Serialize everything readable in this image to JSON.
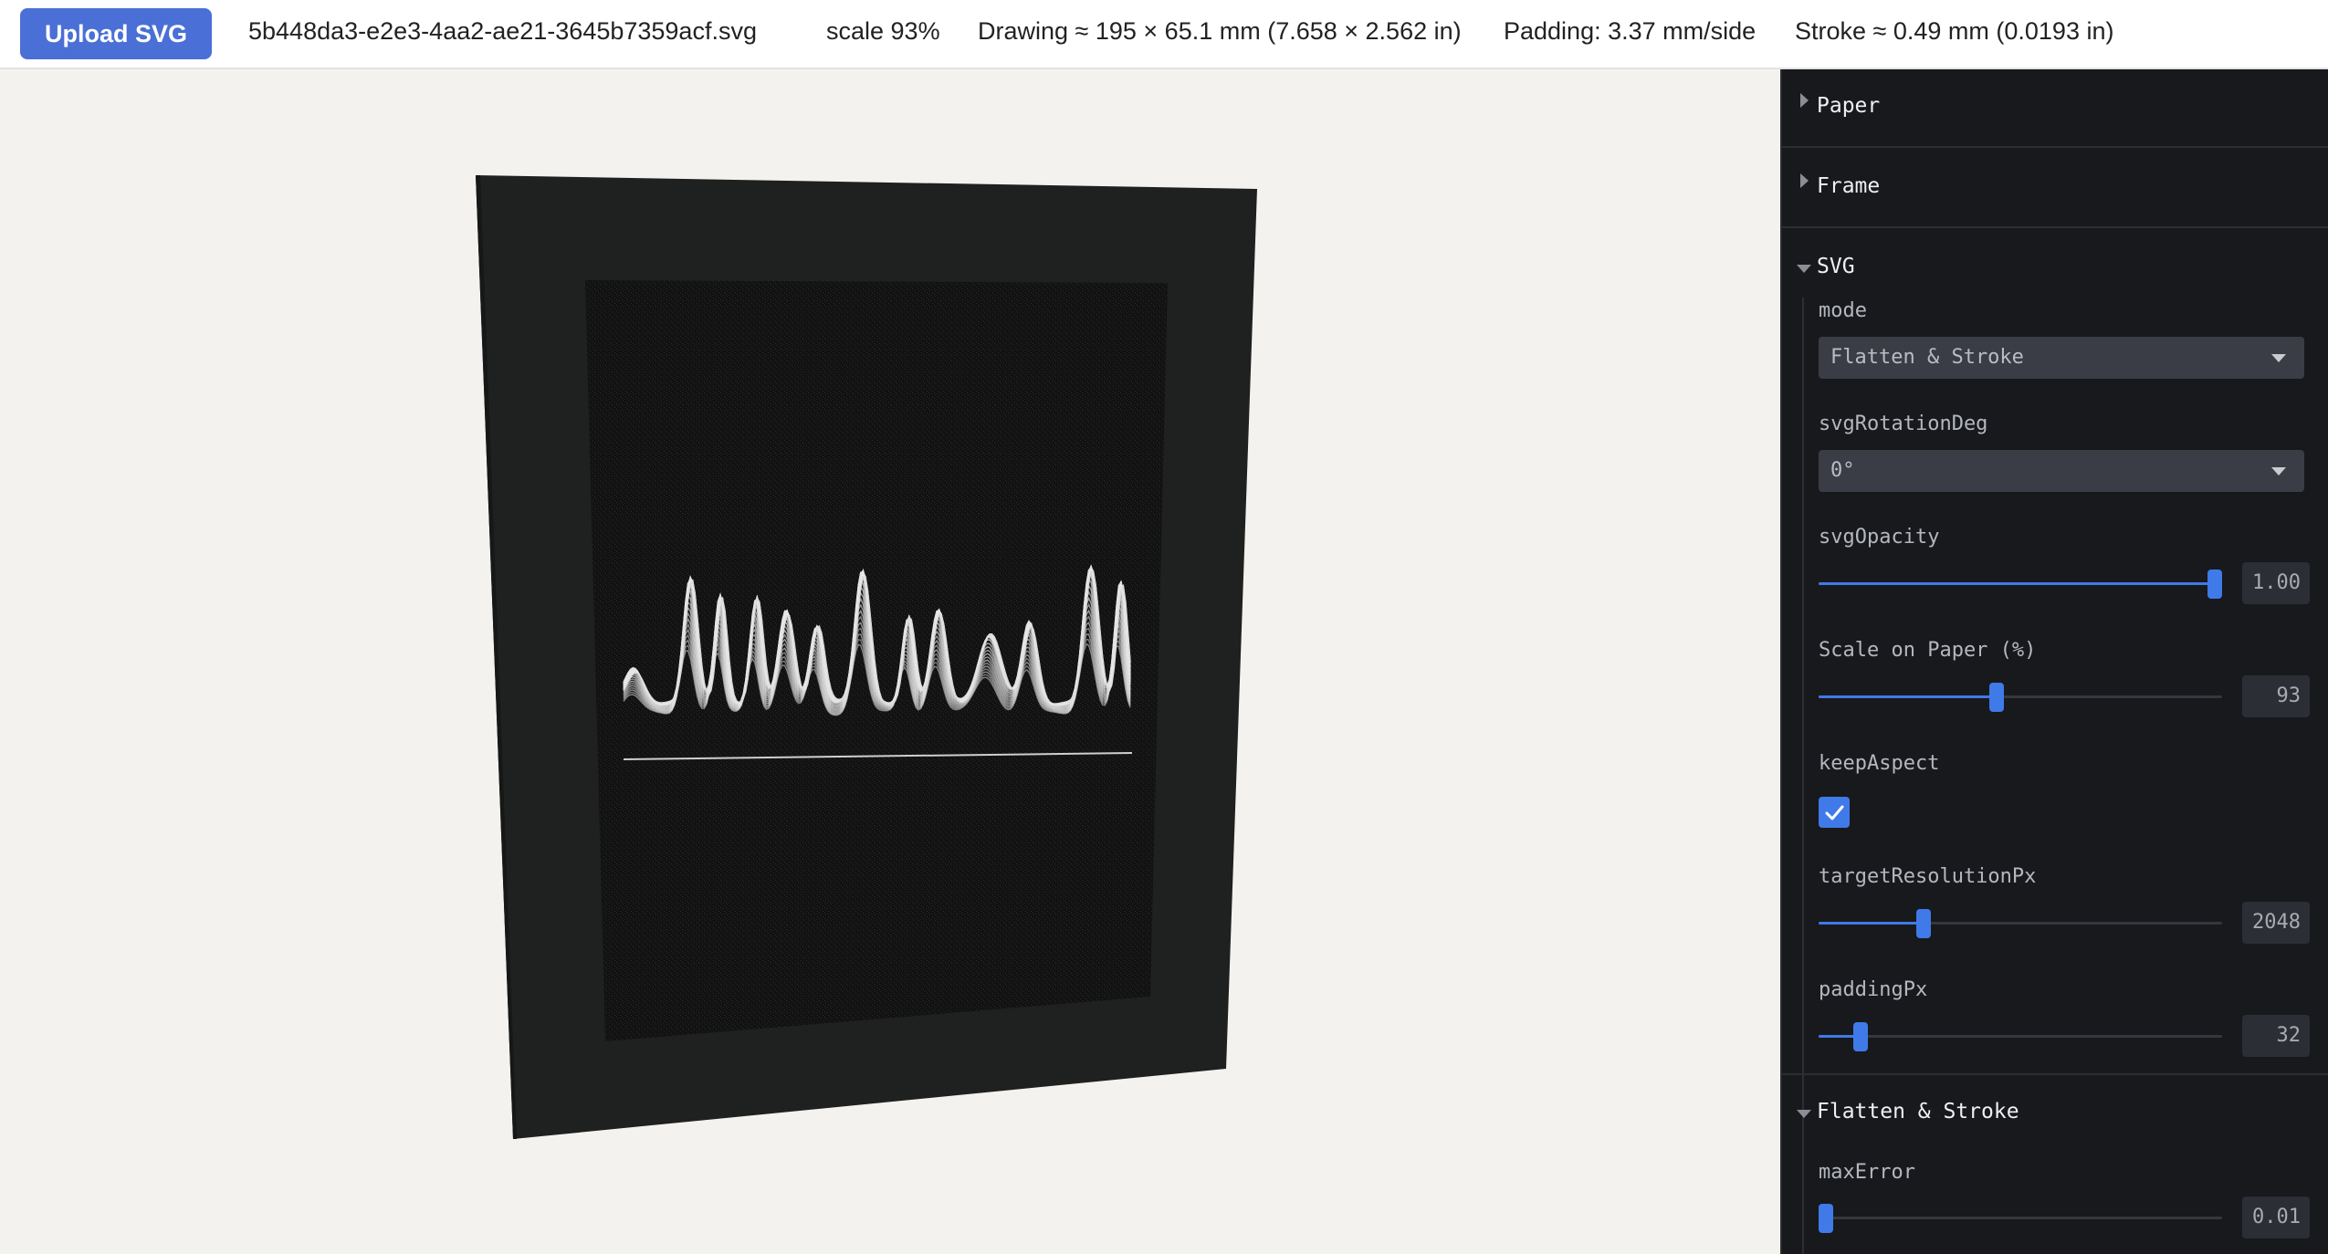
{
  "topbar": {
    "upload_label": "Upload SVG",
    "filename": "5b448da3-e2e3-4aa2-ae21-3645b7359acf.svg",
    "scale": "scale 93%",
    "drawing": "Drawing ≈ 195 × 65.1 mm (7.658 × 2.562 in)",
    "padding": "Padding: 3.37 mm/side",
    "stroke": "Stroke ≈ 0.49 mm (0.0193 in)"
  },
  "panel": {
    "paper": {
      "label": "Paper",
      "open": false
    },
    "frame": {
      "label": "Frame",
      "open": false
    },
    "svg": {
      "label": "SVG",
      "open": true,
      "mode_label": "mode",
      "mode_value": "Flatten & Stroke",
      "rotation_label": "svgRotationDeg",
      "rotation_value": "0°",
      "opacity_label": "svgOpacity",
      "opacity_value": "1.00",
      "opacity_fraction": 1.0,
      "scale_label": "Scale on Paper (%)",
      "scale_value": "93",
      "scale_fraction": 0.44,
      "keep_aspect_label": "keepAspect",
      "keep_aspect_checked": true,
      "resolution_label": "targetResolutionPx",
      "resolution_value": "2048",
      "resolution_fraction": 0.25,
      "padding_label": "paddingPx",
      "padding_value": "32",
      "padding_fraction": 0.09
    },
    "flatten": {
      "label": "Flatten & Stroke",
      "open": true,
      "max_error_label": "maxError",
      "max_error_value": "0.01",
      "max_error_fraction": 0.0
    }
  },
  "colors": {
    "accent": "#3f7ae8",
    "upload_button": "#4a6fd6",
    "frame": "#1e1f1f",
    "mat": "#141414",
    "panel_bg": "#18191c"
  }
}
